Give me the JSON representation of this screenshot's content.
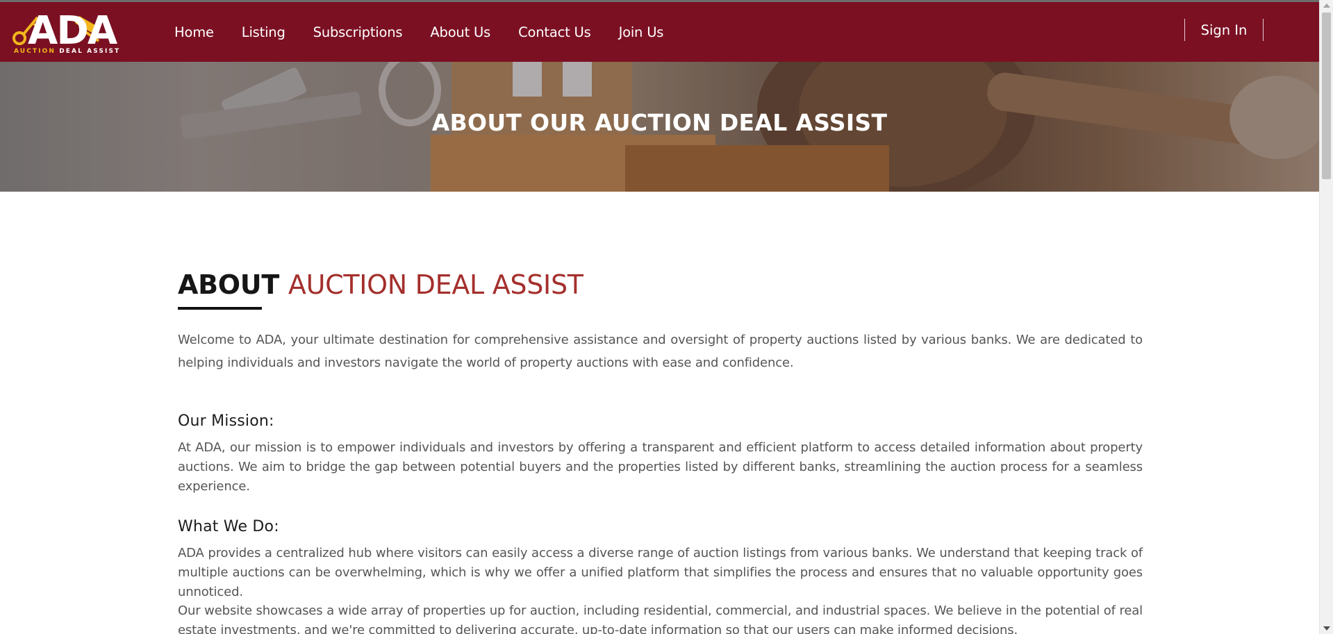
{
  "brand": {
    "logo_text": "ADA",
    "tagline_part1": "AUCTION",
    "tagline_part2": "DEAL ASSIST",
    "primary_color": "#7b1023",
    "accent_color": "#f2b61c",
    "heading_red": "#a42f2c"
  },
  "nav": {
    "items": [
      {
        "label": "Home"
      },
      {
        "label": "Listing"
      },
      {
        "label": "Subscriptions"
      },
      {
        "label": "About Us"
      },
      {
        "label": "Contact Us"
      },
      {
        "label": "Join Us"
      }
    ],
    "sign_in": "Sign In"
  },
  "hero": {
    "title": "ABOUT OUR AUCTION DEAL ASSIST"
  },
  "about": {
    "heading_dark": "ABOUT",
    "heading_red": "AUCTION DEAL ASSIST",
    "intro": "Welcome to ADA, your ultimate destination for comprehensive assistance and oversight of property auctions listed by various banks. We are dedicated to helping individuals and investors navigate the world of property auctions with ease and confidence.",
    "mission_title": "Our Mission:",
    "mission_text": "At ADA, our mission is to empower individuals and investors by offering a transparent and efficient platform to access detailed information about property auctions. We aim to bridge the gap between potential buyers and the properties listed by different banks, streamlining the auction process for a seamless experience.",
    "whatwedo_title": "What We Do:",
    "whatwedo_text": "ADA provides a centralized hub where visitors can easily access a diverse range of auction listings from various banks. We understand that keeping track of multiple auctions can be overwhelming, which is why we offer a unified platform that simplifies the process and ensures that no valuable opportunity goes unnoticed.",
    "showcase_text": "Our website showcases a wide array of properties up for auction, including residential, commercial, and industrial spaces. We believe in the potential of real estate investments, and we're committed to delivering accurate, up-to-date information so that our users can make informed decisions."
  }
}
